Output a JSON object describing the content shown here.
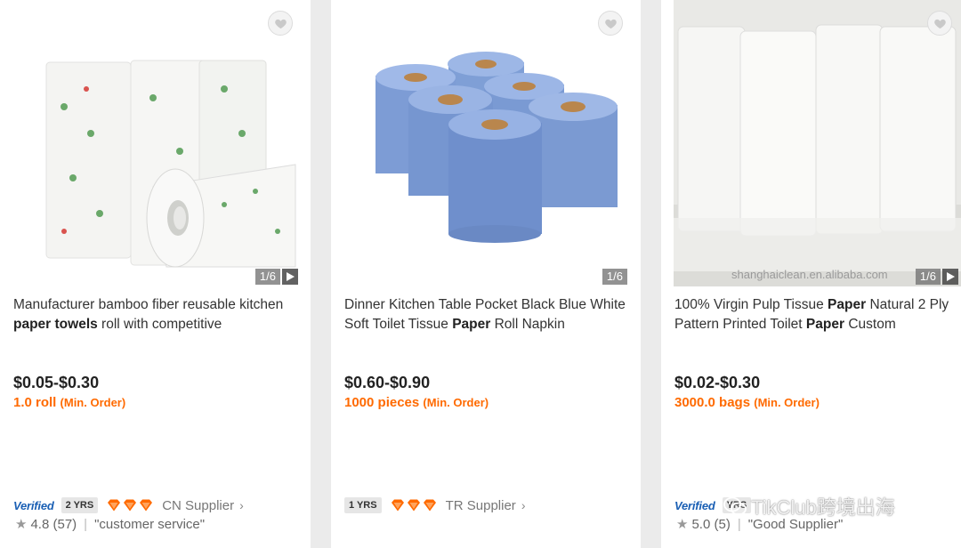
{
  "products": [
    {
      "title_parts": [
        {
          "text": "Manufacturer bamboo fiber reusable kitchen ",
          "bold": false
        },
        {
          "text": "paper towels",
          "bold": true
        },
        {
          "text": " roll with competitive",
          "bold": false
        }
      ],
      "image_counter": "1/6",
      "price": "$0.05-$0.30",
      "moq_value": "1.0 roll",
      "moq_label": "(Min. Order)",
      "verified": "Verified",
      "years": "2 YRS",
      "country": "CN",
      "supplier_label": "Supplier",
      "rating": "4.8",
      "reviews": "(57)",
      "review_tag": "\"customer service\""
    },
    {
      "title_parts": [
        {
          "text": "Dinner Kitchen Table Pocket Black Blue White Soft Toilet Tissue ",
          "bold": false
        },
        {
          "text": "Paper",
          "bold": true
        },
        {
          "text": " Roll Napkin",
          "bold": false
        }
      ],
      "image_counter": "1/6",
      "price": "$0.60-$0.90",
      "moq_value": "1000 pieces",
      "moq_label": "(Min. Order)",
      "years": "1 YRS",
      "country": "TR",
      "supplier_label": "Supplier"
    },
    {
      "title_parts": [
        {
          "text": "100% Virgin Pulp Tissue ",
          "bold": false
        },
        {
          "text": "Paper",
          "bold": true
        },
        {
          "text": " Natural 2 Ply Pattern Printed Toilet ",
          "bold": false
        },
        {
          "text": "Paper",
          "bold": true
        },
        {
          "text": " Custom",
          "bold": false
        }
      ],
      "image_counter": "1/6",
      "image_watermark": "shanghaiclean.en.alibaba.com",
      "price": "$0.02-$0.30",
      "moq_value": "3000.0 bags",
      "moq_label": "(Min. Order)",
      "verified": "Verified",
      "years": "YRS",
      "rating": "5.0",
      "reviews": "(5)",
      "review_tag": "\"Good Supplier\""
    }
  ],
  "overlay_watermark": "TikClub跨境出海",
  "colors": {
    "price": "#222222",
    "moq": "#ff6a00",
    "verified": "#1a5fb4",
    "diamond": "#ff6a00",
    "background": "#ebebeb"
  },
  "icons": [
    "heart-icon",
    "play-icon",
    "diamond-icon",
    "star-icon",
    "chevron-right-icon",
    "wechat-icon"
  ]
}
